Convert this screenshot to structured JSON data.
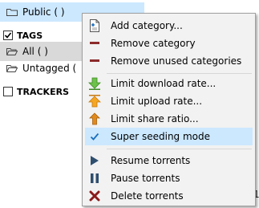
{
  "sidebar": {
    "public": {
      "label": "Public (    )"
    },
    "tags_header": {
      "label": "TAGS",
      "checked": true
    },
    "all": {
      "label": "All (    )"
    },
    "untagged": {
      "label": "Untagged ("
    },
    "trackers_header": {
      "label": "TRACKERS",
      "checked": false
    },
    "edge_text": "1"
  },
  "menu": {
    "items": [
      {
        "label": "Add category...",
        "icon": "add-category-icon"
      },
      {
        "label": "Remove category",
        "icon": "remove-icon"
      },
      {
        "label": "Remove unused categories",
        "icon": "remove-icon"
      },
      {
        "label": "Limit download rate...",
        "icon": "download-arrow-icon"
      },
      {
        "label": "Limit upload rate...",
        "icon": "upload-arrow-icon"
      },
      {
        "label": "Limit share ratio...",
        "icon": "share-ratio-icon"
      },
      {
        "label": "Super seeding mode",
        "icon": "checkmark-icon",
        "checked": true
      },
      {
        "label": "Resume torrents",
        "icon": "play-icon"
      },
      {
        "label": "Pause torrents",
        "icon": "pause-icon"
      },
      {
        "label": "Delete torrents",
        "icon": "delete-x-icon"
      }
    ]
  },
  "colors": {
    "selection": "#cce8ff",
    "remove": "#8b2b2b",
    "download": "#6cc24a",
    "upload": "#f5a623",
    "share": "#e08a1e",
    "check": "#1a6fbf",
    "play": "#2f4f6f",
    "delete": "#8b1a1a"
  }
}
